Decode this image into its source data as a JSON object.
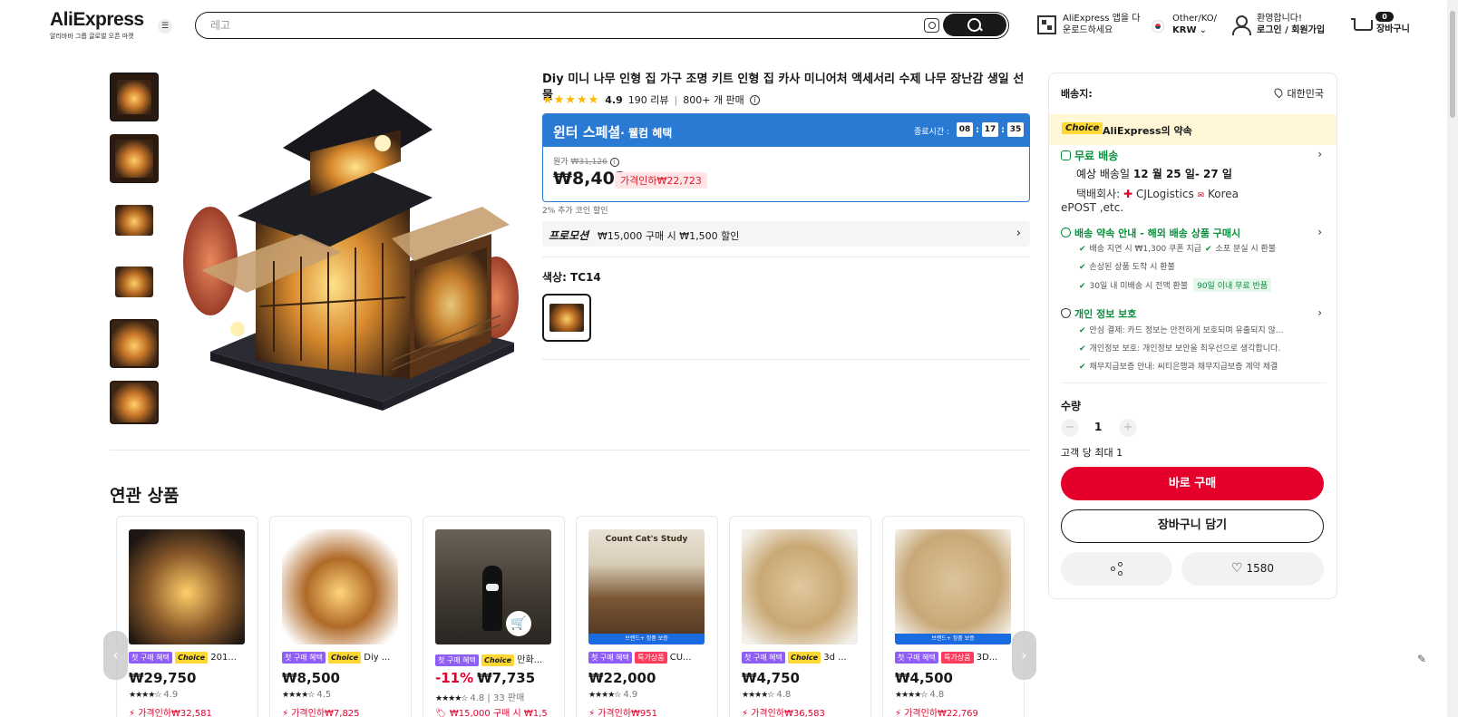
{
  "header": {
    "logo": "AliExpress",
    "logo_sub": "알리바바 그룹 글로벌 오픈 마켓",
    "search_placeholder": "레고",
    "app_line1": "AliExpress 앱을 다",
    "app_line2": "운로드하세요",
    "locale_line1": "Other/KO/",
    "locale_line2": "KRW",
    "user_line1": "환영합니다!",
    "user_line2": "로그인 / 회원가입",
    "cart_count": "0",
    "cart_label": "장바구니"
  },
  "product": {
    "title": "Diy 미니 나무 인형 집 가구 조명 키트 인형 집 카사 미니어처 액세서리 수제 나무 장난감 생일 선물",
    "stars": "★★★★★",
    "rating": "4.9",
    "reviews": "190 리뷰",
    "sold": "800+ 개 판매",
    "banner_title": "윈터 스페셜",
    "banner_sub": "· 웰컴 혜택",
    "ends_label": "종료시간 :",
    "timer": [
      "08",
      "17",
      "35"
    ],
    "orig_label": "원가",
    "orig_price": "₩31,126",
    "price": "₩8,403",
    "discount": "가격인하₩22,723",
    "coin": "2% 추가 코인 할인",
    "promo_label": "프로모션",
    "promo_text": "₩15,000 구매 시 ₩1,500 할인",
    "color_label": "색상: TC14"
  },
  "panel": {
    "ship_to": "배송지:",
    "ship_dest": "대한민국",
    "choice_tag": "Choice",
    "choice_text": "AliExpress의 약속",
    "free_ship": "무료 배송",
    "eta_prefix": "예상 배송일 ",
    "eta_dates": "12 월 25 일- 27 일",
    "carrier_label": "택배회사:",
    "carrier1": "CJLogistics",
    "carrier2": "Korea",
    "carrier_more": "ePOST ,etc.",
    "guarantee_title": "배송 약속 안내 - 해외 배송 상품 구매시",
    "g1": "배송 지연 시 ₩1,300 쿠폰 지급",
    "g2": "소포 분실 시 환불",
    "g3": "손상된 상품 도착 시 환불",
    "g4": "30일 내 미배송 시 전액 환불",
    "g4_tag": "90일 이내 무료 반품",
    "privacy_title": "개인 정보 보호",
    "p1": "안심 결제: 카드 정보는 안전하게 보호되며 유출되지 않...",
    "p2": "개인정보 보호: 개인정보 보안을 최우선으로 생각합니다.",
    "p3": "채무지급보증 안내: 씨티은행과 채무지급보증 계약 체결",
    "qty_label": "수량",
    "qty_value": "1",
    "qty_minus": "−",
    "qty_plus": "+",
    "qty_max": "고객 당 최대 1",
    "buy_now": "바로 구매",
    "add_cart": "장바구니 담기",
    "wish_count": "1580"
  },
  "related": {
    "title": "연관 상품",
    "items": [
      {
        "b1": "첫 구매 혜택",
        "b2": "Choice",
        "name": "201...",
        "disc": "",
        "price": "₩29,750",
        "stars": "★★★★☆",
        "rating": "4.9",
        "sold": "",
        "drop": "가격인하₩32,581"
      },
      {
        "b1": "첫 구매 혜택",
        "b2": "Choice",
        "name": "Diy ...",
        "disc": "",
        "price": "₩8,500",
        "stars": "★★★★☆",
        "rating": "4.5",
        "sold": "",
        "drop": "가격인하₩7,825"
      },
      {
        "b1": "첫 구매 혜택",
        "b2": "Choice",
        "name": "만화...",
        "disc": "-11%",
        "price": "₩7,735",
        "stars": "★★★★☆",
        "rating": "4.8",
        "sold": " | 33 판매",
        "drop": "₩15,000 구매 시 ₩1,5"
      },
      {
        "b1": "첫 구매 혜택",
        "b3": "특가상품",
        "name": "CU...",
        "disc": "",
        "price": "₩22,000",
        "stars": "★★★★☆",
        "rating": "4.9",
        "sold": "",
        "drop": "가격인하₩951",
        "brand": "브랜드+ 정품 보증",
        "img_title": "Count Cat's Study"
      },
      {
        "b1": "첫 구매 혜택",
        "b2": "Choice",
        "name": "3d ...",
        "disc": "",
        "price": "₩4,750",
        "stars": "★★★★☆",
        "rating": "4.8",
        "sold": "",
        "drop": "가격인하₩36,583"
      },
      {
        "b1": "첫 구매 혜택",
        "b3": "특가상품",
        "name": "3D...",
        "disc": "",
        "price": "₩4,500",
        "stars": "★★★★☆",
        "rating": "4.8",
        "sold": "",
        "drop": "가격인하₩22,769",
        "brand": "브랜드+ 정품 보증"
      }
    ]
  },
  "colors": {
    "accent_red": "#e4002b",
    "blue": "#2a7ad4",
    "green": "#0a8f3c",
    "choice_yellow": "#fdd835"
  }
}
